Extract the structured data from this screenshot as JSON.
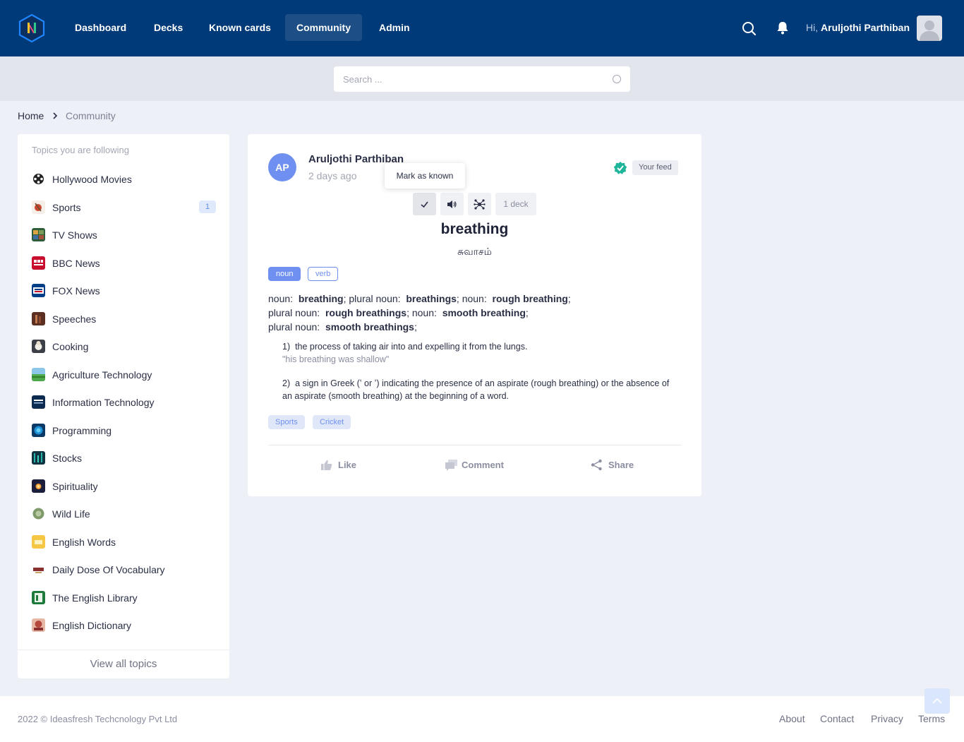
{
  "brand": {
    "logo_letter": "N",
    "accent": "#003a78"
  },
  "nav": {
    "items": [
      {
        "label": "Dashboard",
        "active": false
      },
      {
        "label": "Decks",
        "active": false
      },
      {
        "label": "Known cards",
        "active": false
      },
      {
        "label": "Community",
        "active": true
      },
      {
        "label": "Admin",
        "active": false
      }
    ],
    "icons": [
      "search-icon",
      "bell-icon"
    ],
    "greeting_prefix": "Hi,",
    "user_name": "Aruljothi Parthiban"
  },
  "search": {
    "placeholder": "Search ..."
  },
  "breadcrumb": {
    "home": "Home",
    "current": "Community"
  },
  "sidebar": {
    "title": "Topics you are following",
    "topics": [
      {
        "label": "Hollywood Movies",
        "icon": "film-reel-icon"
      },
      {
        "label": "Sports",
        "icon": "sports-icon",
        "count": "1"
      },
      {
        "label": "TV Shows",
        "icon": "tv-shows-icon"
      },
      {
        "label": "BBC News",
        "icon": "bbc-news-icon"
      },
      {
        "label": "FOX News",
        "icon": "fox-news-icon"
      },
      {
        "label": "Speeches",
        "icon": "speeches-icon"
      },
      {
        "label": "Cooking",
        "icon": "cooking-icon"
      },
      {
        "label": "Agriculture Technology",
        "icon": "agriculture-icon"
      },
      {
        "label": "Information Technology",
        "icon": "information-technology-icon"
      },
      {
        "label": "Programming",
        "icon": "programming-icon"
      },
      {
        "label": "Stocks",
        "icon": "stocks-icon"
      },
      {
        "label": "Spirituality",
        "icon": "spirituality-icon"
      },
      {
        "label": "Wild Life",
        "icon": "wild-life-icon"
      },
      {
        "label": "English Words",
        "icon": "english-words-icon"
      },
      {
        "label": "Daily Dose Of Vocabulary",
        "icon": "vocabulary-icon"
      },
      {
        "label": "The English Library",
        "icon": "library-icon"
      },
      {
        "label": "English Dictionary",
        "icon": "dictionary-icon"
      }
    ],
    "view_all": "View all topics"
  },
  "card": {
    "author_initials": "AP",
    "author_name": "Aruljothi Parthiban",
    "time": "2 days ago",
    "feed_badge": "Your feed",
    "tooltip": "Mark as known",
    "deck_count": "1 deck",
    "word": "breathing",
    "translation": "சுவாசம்",
    "pos_tags": [
      "noun",
      "verb"
    ],
    "forms": [
      {
        "kind": "noun:",
        "form": "breathing"
      },
      {
        "kind": "plural noun:",
        "form": "breathings"
      },
      {
        "kind": "noun:",
        "form": "rough breathing"
      },
      {
        "kind": "plural noun:",
        "form": "rough breathings"
      },
      {
        "kind": "noun:",
        "form": "smooth breathing"
      },
      {
        "kind": "plural noun:",
        "form": "smooth breathings"
      }
    ],
    "senses": [
      {
        "number": "1)",
        "definition": "the process of taking air into and expelling it from the lungs.",
        "example": "\"his breathing was shallow\""
      },
      {
        "number": "2)",
        "definition": "a sign in Greek (ʽ or ʼ) indicating the presence of an aspirate (rough breathing) or the absence of an aspirate (smooth breathing) at the beginning of a word.",
        "example": ""
      }
    ],
    "topic_tags": [
      "Sports",
      "Cricket"
    ],
    "actions": {
      "like": "Like",
      "comment": "Comment",
      "share": "Share"
    }
  },
  "footer": {
    "copyright": "2022 © Ideasfresh Techcnology Pvt Ltd",
    "links": [
      "About",
      "Contact",
      "Privacy",
      "Terms"
    ]
  }
}
